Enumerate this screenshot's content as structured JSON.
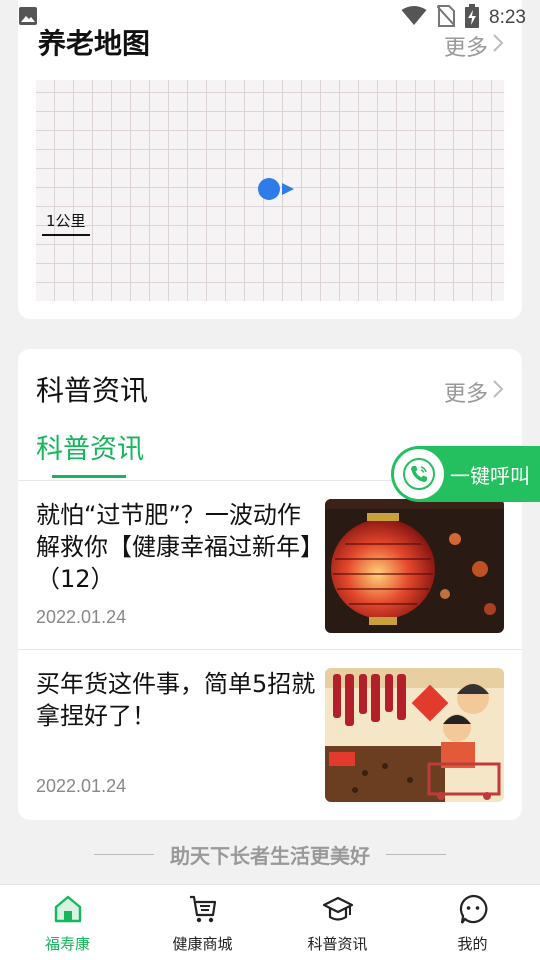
{
  "status_bar": {
    "time": "8:23",
    "icons": [
      "image-icon",
      "wifi-icon",
      "no-sim-icon",
      "battery-charging-icon"
    ]
  },
  "map_card": {
    "title": "养老地图",
    "more_label": "更多",
    "scale_label": "1公里"
  },
  "news_card": {
    "title": "科普资讯",
    "more_label": "更多",
    "tab_label": "科普资讯",
    "articles": [
      {
        "title": "就怕“过节肥”？一波动作解救你【健康幸福过新年】（12）",
        "date": "2022.01.24",
        "image": "red-lantern-photo"
      },
      {
        "title": "买年货这件事，简单5招就拿捏好了！",
        "date": "2022.01.24",
        "image": "new-year-shopping-illustration"
      }
    ]
  },
  "call_button": {
    "label": "一键呼叫",
    "icon": "phone-icon"
  },
  "slogan": "助天下长者生活更美好",
  "bottom_nav": {
    "items": [
      {
        "label": "福寿康",
        "icon": "home-icon",
        "active": true
      },
      {
        "label": "健康商城",
        "icon": "cart-icon",
        "active": false
      },
      {
        "label": "科普资讯",
        "icon": "graduation-cap-icon",
        "active": false
      },
      {
        "label": "我的",
        "icon": "profile-face-icon",
        "active": false
      }
    ]
  },
  "colors": {
    "accent": "#16b65c",
    "call_button": "#24c05f",
    "location_dot": "#2f7be8"
  }
}
